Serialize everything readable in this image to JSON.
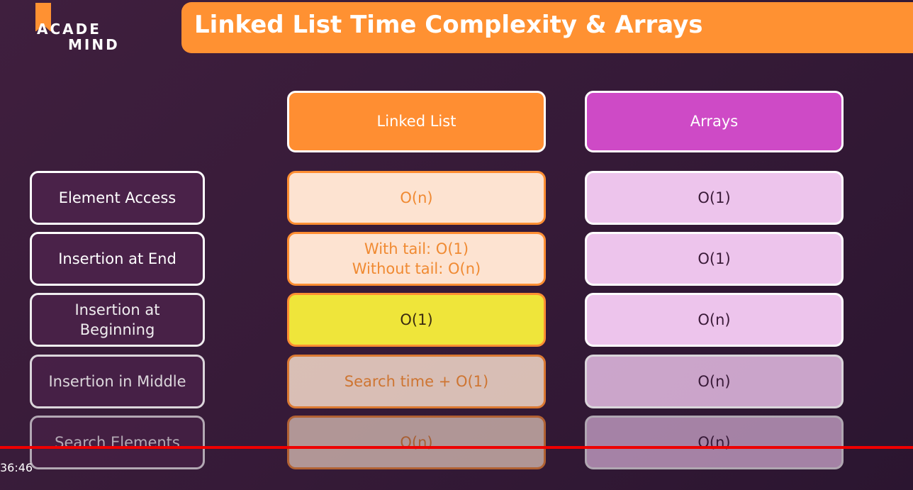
{
  "logo": {
    "line1": "ACADE",
    "line2": "MIND"
  },
  "slide": {
    "title": "Linked List Time Complexity & Arrays",
    "columns": [
      "Linked List",
      "Arrays"
    ],
    "rows": [
      {
        "label": "Element Access",
        "linked_list": "O(n)",
        "arrays": "O(1)"
      },
      {
        "label": "Insertion at End",
        "linked_list": "With tail: O(1)\nWithout tail: O(n)",
        "arrays": "O(1)"
      },
      {
        "label": "Insertion at\nBeginning",
        "linked_list": "O(1)",
        "arrays": "O(n)"
      },
      {
        "label": "Insertion in Middle",
        "linked_list": "Search time + O(1)",
        "arrays": "O(n)"
      },
      {
        "label": "Search Elements",
        "linked_list": "O(n)",
        "arrays": "O(n)"
      }
    ]
  },
  "player": {
    "timecode": "36:46"
  },
  "colors": {
    "accent_orange": "#ff9132",
    "accent_magenta": "#ce4ac6",
    "highlight_yellow": "#efe53a",
    "progress_red": "#ee0000"
  }
}
